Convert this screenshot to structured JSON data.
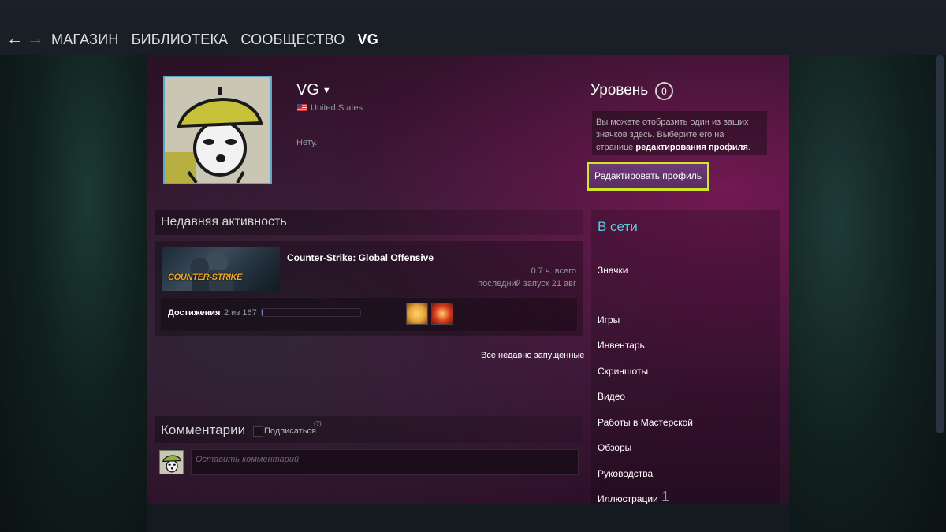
{
  "nav": {
    "back_icon": "arrow-left-icon",
    "forward_icon": "arrow-right-icon",
    "links": [
      "МАГАЗИН",
      "БИБЛИОТЕКА",
      "СООБЩЕСТВО",
      "VG"
    ]
  },
  "profile": {
    "username": "VG",
    "country": "United States",
    "summary": "Нету.",
    "level_label": "Уровень",
    "level": "0",
    "badge_hint_text": "Вы можете отобразить один из ваших значков здесь. Выберите его на странице ",
    "badge_hint_link": "редактирования профиля",
    "badge_hint_end": ".",
    "edit_button": "Редактировать профиль",
    "status": "В сети"
  },
  "activity": {
    "title": "Недавняя активность",
    "game_name": "Counter-Strike: Global Offensive",
    "capsule_logo": "COUNTER-STRIKE",
    "hours": "0.7 ч. всего",
    "last_played": "последний запуск 21 авг",
    "achievements_label": "Достижения",
    "achievements_count": "2 из 167",
    "achievements_progress": 0.012,
    "all_recent_link": "Все недавно запущенные"
  },
  "comments": {
    "title": "Комментарии",
    "subscribe_label": "Подписаться",
    "help_mark": "(?)",
    "placeholder": "Оставить комментарий"
  },
  "sidebar": {
    "items": [
      "Значки",
      "Игры",
      "Инвентарь",
      "Скриншоты",
      "Видео",
      "Работы в Мастерской",
      "Обзоры",
      "Руководства",
      "Иллюстрации"
    ],
    "illustrations_count": "1"
  },
  "colors": {
    "highlight_border": "#cfe628",
    "status_online": "#57cbde",
    "edit_button_bg": "#6e3a78"
  }
}
